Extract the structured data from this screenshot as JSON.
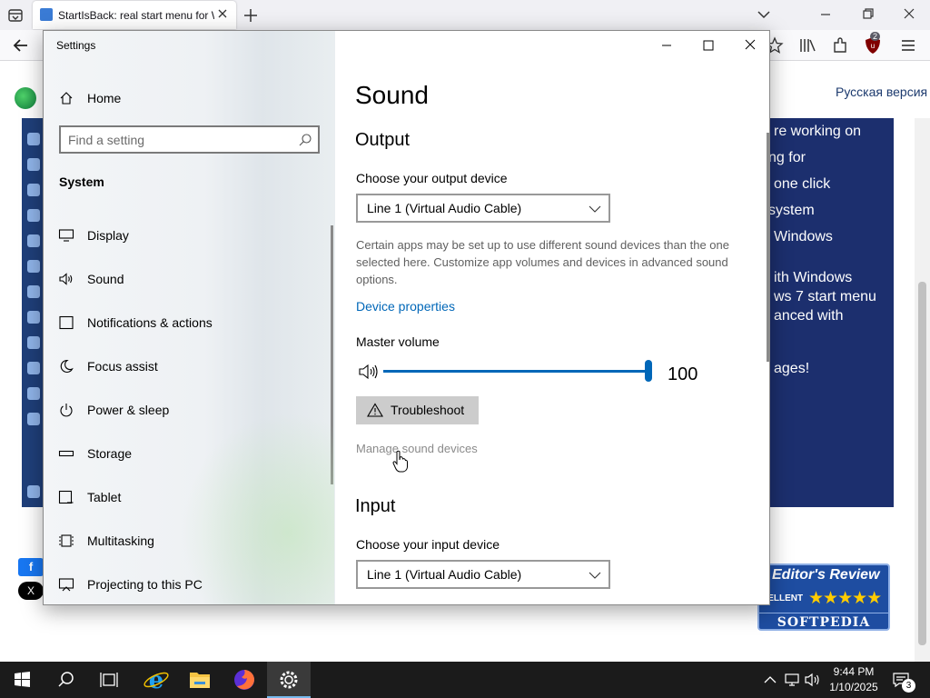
{
  "browser": {
    "tab_title": "StartIsBack: real start menu for W",
    "toolbar_badge": "2"
  },
  "web_page": {
    "russian_link": "Русская версия",
    "banner_lines": [
      "re working on",
      "ng for",
      "one click",
      "system",
      "Windows",
      "ith Windows",
      "ws 7 start menu",
      "anced with",
      "ages!"
    ],
    "share_facebook": "f",
    "share_x": "X",
    "review": {
      "title": "Editor's Review",
      "rating_label": "CELLENT",
      "stars": "★★★★★",
      "brand": "SOFTPEDIA"
    }
  },
  "settings": {
    "window_title": "Settings",
    "sidebar": {
      "home_label": "Home",
      "search_placeholder": "Find a setting",
      "section": "System",
      "items": [
        {
          "label": "Display",
          "icon": "display-icon"
        },
        {
          "label": "Sound",
          "icon": "speaker-icon"
        },
        {
          "label": "Notifications & actions",
          "icon": "notifications-icon"
        },
        {
          "label": "Focus assist",
          "icon": "moon-icon"
        },
        {
          "label": "Power & sleep",
          "icon": "power-icon"
        },
        {
          "label": "Storage",
          "icon": "storage-icon"
        },
        {
          "label": "Tablet",
          "icon": "tablet-icon"
        },
        {
          "label": "Multitasking",
          "icon": "multitasking-icon"
        },
        {
          "label": "Projecting to this PC",
          "icon": "projecting-icon"
        }
      ]
    },
    "content": {
      "title": "Sound",
      "output_heading": "Output",
      "output_device_label": "Choose your output device",
      "output_device_value": "Line 1 (Virtual Audio Cable)",
      "description": "Certain apps may be set up to use different sound devices than the one selected here. Customize app volumes and devices in advanced sound options.",
      "device_properties_link": "Device properties",
      "master_volume_label": "Master volume",
      "master_volume_value": "100",
      "master_volume_level": 1.0,
      "troubleshoot_label": "Troubleshoot",
      "manage_devices_link": "Manage sound devices",
      "input_heading": "Input",
      "input_device_label": "Choose your input device",
      "input_device_value": "Line 1 (Virtual Audio Cable)"
    }
  },
  "taskbar": {
    "time": "9:44 PM",
    "date": "1/10/2025",
    "notification_count": "3"
  },
  "colors": {
    "accent": "#0067b8",
    "taskbar": "#1b1b1b",
    "banner": "#1c2f6e"
  }
}
